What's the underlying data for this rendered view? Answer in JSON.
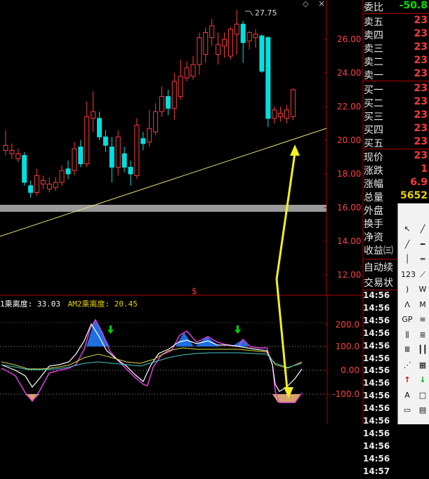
{
  "window": {
    "title": ""
  },
  "top_icons": {
    "collapse": "◇",
    "close": "×"
  },
  "price_chart": {
    "axis_ticks": [
      "26.00",
      "24.00",
      "22.00",
      "20.00",
      "18.00",
      "16.00",
      "14.00",
      "12.00"
    ],
    "max_label": "27.75",
    "marker": "$",
    "candles": [
      {
        "o": 19.4,
        "c": 19.7,
        "h": 20.6,
        "l": 19.1
      },
      {
        "o": 19.2,
        "c": 19.4,
        "h": 19.8,
        "l": 18.9
      },
      {
        "o": 18.9,
        "c": 19.2,
        "h": 19.5,
        "l": 18.7
      },
      {
        "o": 19.1,
        "c": 17.5,
        "h": 19.3,
        "l": 17.3
      },
      {
        "o": 17.3,
        "c": 16.9,
        "h": 17.6,
        "l": 16.6
      },
      {
        "o": 16.9,
        "c": 17.9,
        "h": 18.3,
        "l": 16.7
      },
      {
        "o": 17.4,
        "c": 17.6,
        "h": 17.9,
        "l": 17.1
      },
      {
        "o": 17.1,
        "c": 17.4,
        "h": 17.8,
        "l": 16.9
      },
      {
        "o": 17.2,
        "c": 17.5,
        "h": 17.8,
        "l": 17.0
      },
      {
        "o": 17.5,
        "c": 18.2,
        "h": 18.5,
        "l": 17.3
      },
      {
        "o": 18.3,
        "c": 18.0,
        "h": 18.8,
        "l": 17.7
      },
      {
        "o": 18.2,
        "c": 19.5,
        "h": 19.9,
        "l": 17.9
      },
      {
        "o": 19.6,
        "c": 18.6,
        "h": 20.0,
        "l": 18.4
      },
      {
        "o": 18.6,
        "c": 21.4,
        "h": 22.3,
        "l": 18.4
      },
      {
        "o": 21.3,
        "c": 21.7,
        "h": 22.9,
        "l": 20.5
      },
      {
        "o": 21.3,
        "c": 20.2,
        "h": 21.7,
        "l": 20.0
      },
      {
        "o": 20.2,
        "c": 19.7,
        "h": 20.6,
        "l": 19.3
      },
      {
        "o": 19.6,
        "c": 18.4,
        "h": 20.2,
        "l": 17.5
      },
      {
        "o": 18.4,
        "c": 20.2,
        "h": 20.6,
        "l": 17.9
      },
      {
        "o": 19.2,
        "c": 18.4,
        "h": 19.6,
        "l": 18.1
      },
      {
        "o": 18.4,
        "c": 18.0,
        "h": 18.8,
        "l": 17.3
      },
      {
        "o": 17.9,
        "c": 20.9,
        "h": 21.3,
        "l": 17.7
      },
      {
        "o": 20.1,
        "c": 19.8,
        "h": 20.5,
        "l": 19.4
      },
      {
        "o": 19.9,
        "c": 20.7,
        "h": 21.8,
        "l": 19.6
      },
      {
        "o": 20.5,
        "c": 21.7,
        "h": 22.2,
        "l": 20.3
      },
      {
        "o": 21.7,
        "c": 22.6,
        "h": 23.2,
        "l": 21.4
      },
      {
        "o": 22.6,
        "c": 21.9,
        "h": 23.0,
        "l": 21.5
      },
      {
        "o": 21.9,
        "c": 23.5,
        "h": 24.0,
        "l": 21.2
      },
      {
        "o": 22.6,
        "c": 23.8,
        "h": 24.8,
        "l": 22.4
      },
      {
        "o": 23.7,
        "c": 24.3,
        "h": 24.7,
        "l": 23.5
      },
      {
        "o": 23.8,
        "c": 24.5,
        "h": 25.0,
        "l": 23.6
      },
      {
        "o": 24.5,
        "c": 26.1,
        "h": 26.4,
        "l": 23.9
      },
      {
        "o": 25.1,
        "c": 26.4,
        "h": 26.7,
        "l": 24.6
      },
      {
        "o": 26.1,
        "c": 26.8,
        "h": 27.2,
        "l": 25.6
      },
      {
        "o": 25.1,
        "c": 25.7,
        "h": 26.4,
        "l": 24.5
      },
      {
        "o": 25.6,
        "c": 26.0,
        "h": 26.4,
        "l": 24.9
      },
      {
        "o": 25.0,
        "c": 26.6,
        "h": 26.7,
        "l": 24.8
      },
      {
        "o": 26.3,
        "c": 26.9,
        "h": 27.75,
        "l": 25.1
      },
      {
        "o": 26.9,
        "c": 25.8,
        "h": 27.1,
        "l": 24.6
      },
      {
        "o": 25.9,
        "c": 26.4,
        "h": 26.5,
        "l": 25.4
      },
      {
        "o": 26.1,
        "c": 26.3,
        "h": 26.6,
        "l": 25.5
      },
      {
        "o": 26.2,
        "c": 24.1,
        "h": 26.3,
        "l": 24.0
      },
      {
        "o": 26.1,
        "c": 21.3,
        "h": 26.2,
        "l": 20.8
      },
      {
        "o": 21.3,
        "c": 21.8,
        "h": 22.0,
        "l": 21.0
      },
      {
        "o": 21.4,
        "c": 21.6,
        "h": 22.0,
        "l": 21.1
      },
      {
        "o": 21.3,
        "c": 21.8,
        "h": 22.1,
        "l": 21.0
      },
      {
        "o": 21.4,
        "c": 23.0,
        "h": 23.1,
        "l": 21.2
      }
    ]
  },
  "indicator": {
    "legend_1": "1乘离度: 33.03",
    "legend_2": "AM2乘离度: 20.45",
    "axis_ticks": [
      "200.0",
      "100.0",
      "0.00",
      "-100.0"
    ]
  },
  "quote_panel": {
    "committee_label": "委比",
    "committee_value": "-50.8",
    "ask_rows": [
      {
        "label": "卖五",
        "value": "23"
      },
      {
        "label": "卖四",
        "value": "23"
      },
      {
        "label": "卖三",
        "value": "23"
      },
      {
        "label": "卖二",
        "value": "23"
      },
      {
        "label": "卖一",
        "value": "23"
      }
    ],
    "bid_rows": [
      {
        "label": "买一",
        "value": "23"
      },
      {
        "label": "买二",
        "value": "23"
      },
      {
        "label": "买三",
        "value": "23"
      },
      {
        "label": "买四",
        "value": "23"
      },
      {
        "label": "买五",
        "value": "23"
      }
    ],
    "stats": [
      {
        "label": "现价",
        "value": "23"
      },
      {
        "label": "涨跌",
        "value": "1"
      },
      {
        "label": "涨幅",
        "value": "6.9"
      },
      {
        "label": "总量",
        "value": "5652"
      },
      {
        "label": "外盘",
        "value": ""
      },
      {
        "label": "换手",
        "value": ""
      },
      {
        "label": "净资",
        "value": ""
      },
      {
        "label": "收益㈢",
        "value": ""
      }
    ],
    "auto_label": "自动续",
    "trade_label": "交易状",
    "colors": {
      "up": "#ff3b3b",
      "down": "#00e0e0",
      "title_yellow": "#e8d000",
      "value_green": "#00e000"
    }
  },
  "ticks": [
    "14:56",
    "14:56",
    "14:56",
    "14:56",
    "14:56",
    "14:56",
    "14:56",
    "14:56",
    "14:56",
    "14:56",
    "14:56",
    "14:56",
    "14:56",
    "14:56",
    "14:57"
  ],
  "toolbox_icons": [
    "cursor-icon",
    "line-icon",
    "ray-icon",
    "horizontal-line-icon",
    "vertical-line-icon",
    "parallel-lines-icon",
    "text-123-icon",
    "segment-icon",
    "arc-icon",
    "wave-icon",
    "pattern-icon",
    "m-pattern-icon",
    "gp-icon",
    "fibonacci-icon",
    "time-zone-icon",
    "channel-icon",
    "gann-icon",
    "bar-icon",
    "fan-icon",
    "grid-icon",
    "up-arrow-icon",
    "down-arrow-icon",
    "text-icon",
    "box-icon",
    "ruler-icon",
    "scroll-icon"
  ]
}
